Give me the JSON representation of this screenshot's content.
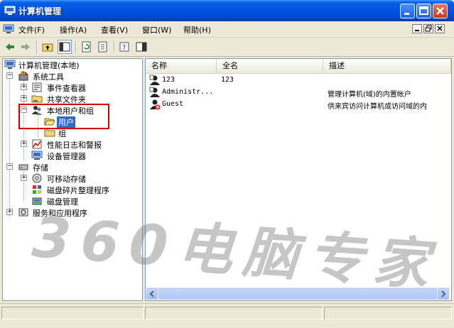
{
  "window": {
    "title": "计算机管理"
  },
  "menu": {
    "items": [
      {
        "label": "文件(F)"
      },
      {
        "label": "操作(A)"
      },
      {
        "label": "查看(V)"
      },
      {
        "label": "窗口(W)"
      },
      {
        "label": "帮助(H)"
      }
    ]
  },
  "tree": {
    "root": "计算机管理(本地)",
    "system_tools": "系统工具",
    "event_viewer": "事件查看器",
    "shared_folders": "共享文件夹",
    "local_users_groups": "本地用户和组",
    "users": "用户",
    "groups": "组",
    "perf_logs": "性能日志和警报",
    "device_manager": "设备管理器",
    "storage": "存储",
    "removable_storage": "可移动存储",
    "defrag": "磁盘碎片整理程序",
    "disk_mgmt": "磁盘管理",
    "services_apps": "服务和应用程序"
  },
  "list": {
    "columns": [
      "名称",
      "全名",
      "描述"
    ],
    "rows": [
      {
        "name": "123",
        "fullname": "123",
        "description": "",
        "disabled": false
      },
      {
        "name": "Administr...",
        "fullname": "",
        "description": "管理计算机(域)的内置帐户",
        "disabled": false
      },
      {
        "name": "Guest",
        "fullname": "",
        "description": "供来宾访问计算机或访问域的内",
        "disabled": true
      }
    ]
  },
  "watermark": {
    "text": "360电脑专家"
  },
  "colors": {
    "titlebar": "#0054e3",
    "selection": "#316ac5",
    "highlight_box": "#d00000"
  }
}
